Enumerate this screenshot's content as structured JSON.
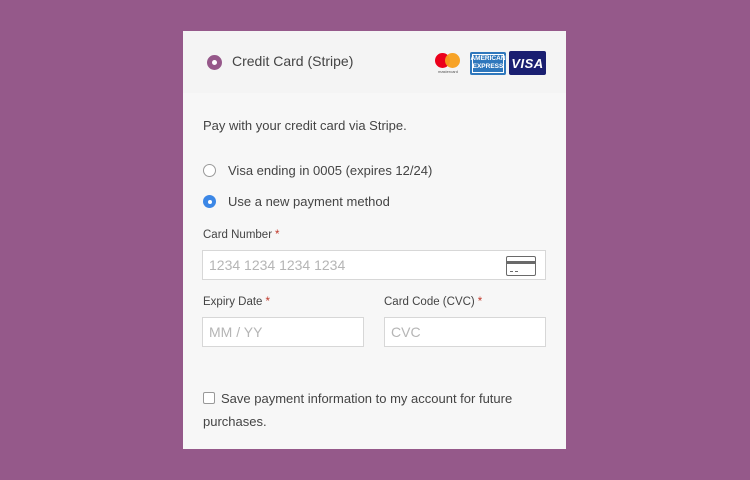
{
  "header": {
    "method_label": "Credit Card (Stripe)",
    "logos": {
      "mastercard_text": "mastercard",
      "amex_line1": "AMERICAN",
      "amex_line2": "EXPRESS",
      "visa_text": "VISA"
    }
  },
  "description": "Pay with your credit card via Stripe.",
  "saved_methods": [
    {
      "label": "Visa ending in 0005 (expires 12/24)",
      "selected": false
    },
    {
      "label": "Use a new payment method",
      "selected": true
    }
  ],
  "fields": {
    "card_number": {
      "label": "Card Number",
      "required_mark": "*",
      "placeholder": "1234 1234 1234 1234",
      "value": ""
    },
    "expiry": {
      "label": "Expiry Date",
      "required_mark": "*",
      "placeholder": "MM / YY",
      "value": ""
    },
    "cvc": {
      "label": "Card Code (CVC)",
      "required_mark": "*",
      "placeholder": "CVC",
      "value": ""
    }
  },
  "save_option": {
    "label": "Save payment information to my account for future purchases.",
    "checked": false
  },
  "colors": {
    "background": "#95598a",
    "header_radio": "#96588a",
    "selected_radio": "#3c87e6",
    "required": "#c0392b"
  },
  "icons": [
    "radio-selected-icon",
    "mastercard-logo-icon",
    "amex-logo-icon",
    "visa-logo-icon",
    "credit-card-icon"
  ]
}
